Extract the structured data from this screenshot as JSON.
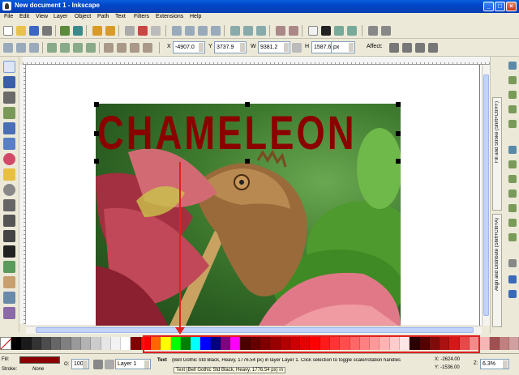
{
  "window": {
    "title": "New document 1 - Inkscape",
    "buttons": {
      "minimize": "_",
      "maximize": "□",
      "close": "×"
    }
  },
  "menu": [
    "File",
    "Edit",
    "View",
    "Layer",
    "Object",
    "Path",
    "Text",
    "Filters",
    "Extensions",
    "Help"
  ],
  "controls": {
    "x_label": "X",
    "x_value": "-4907.0",
    "y_label": "Y",
    "y_value": "3737.9",
    "w_label": "W",
    "w_value": "9381.2",
    "h_label": "H",
    "h_value": "1587.6",
    "unit": "px",
    "affect_label": "Affect:"
  },
  "canvas": {
    "text_object": "CHAMELEON",
    "text_color": "#8b0000"
  },
  "dock": {
    "tab_fill_stroke": "Fill and Stroke (Shift+Ctrl+F)",
    "tab_align": "Align and Distribute (Shift+Ctrl+A)"
  },
  "palette": {
    "colors": [
      "#000000",
      "#1a1a1a",
      "#333333",
      "#4d4d4d",
      "#666666",
      "#808080",
      "#999999",
      "#b3b3b3",
      "#cccccc",
      "#e6e6e6",
      "#f2f2f2",
      "#ffffff",
      "#800000",
      "#ff0000",
      "#ff6600",
      "#ffff00",
      "#00ff00",
      "#008000",
      "#00ffff",
      "#0000ff",
      "#000080",
      "#800080",
      "#ff00ff",
      "#4d0000",
      "#660000",
      "#800000",
      "#990000",
      "#b30000",
      "#cc0000",
      "#e60000",
      "#ff0000",
      "#ff1a1a",
      "#ff3333",
      "#ff4d4d",
      "#ff6666",
      "#ff8080",
      "#ff9999",
      "#ffb3b3",
      "#ffcccc",
      "#ffe6e6",
      "#2b0000",
      "#550000",
      "#800b0b",
      "#aa1111",
      "#d41717",
      "#e84848",
      "#f28a8a",
      "#f7b5b5",
      "#a05050",
      "#c08080",
      "#d0a0a0"
    ]
  },
  "status": {
    "fill_label": "Fill:",
    "stroke_label": "Stroke:",
    "stroke_value": "None",
    "opacity_label": "O:",
    "opacity_value": "100",
    "layer": "Layer 1",
    "message_bold": "Text",
    "message": "(Bell Gothic Std Black, Heavy, 1776.54 px) in layer Layer 1. Click selection to toggle scale/rotation handles",
    "tooltip": "Text (Bell Gothic Std Black, Heavy, 1776.54 px) in",
    "coord_x": "X: -2624.00",
    "coord_y": "Y: -1536.00",
    "zoom_label": "Z:",
    "zoom_value": "6.3%"
  },
  "accent": {
    "annotation": "#e02020",
    "titlebar": "#0a5ddb"
  }
}
